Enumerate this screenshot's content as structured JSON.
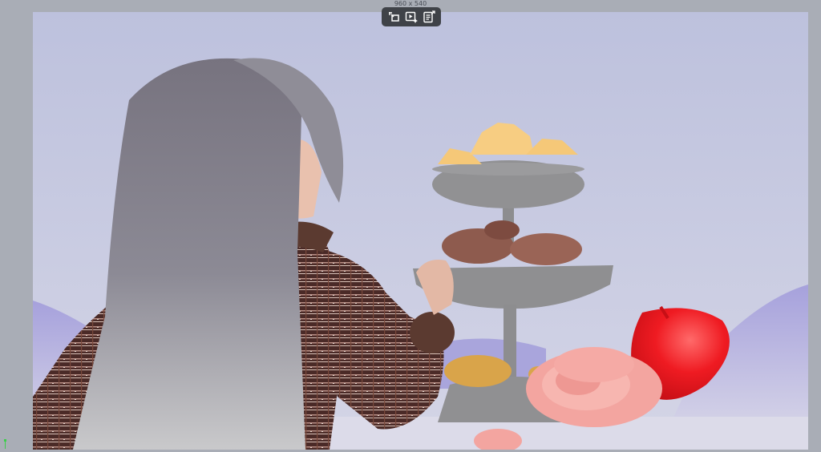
{
  "canvas": {
    "size_label": "960 x 540"
  },
  "toolbar": {
    "buttons": [
      {
        "name": "crop-frame-icon"
      },
      {
        "name": "play-sparkle-icon"
      },
      {
        "name": "notes-export-icon"
      }
    ]
  },
  "colors": {
    "sky": "#c6c9e0",
    "ground": "#b7b4dd",
    "hair": "#8a8893",
    "sweater": "#4b2c28",
    "stand": "#8d8d8f",
    "apple": "#ef1b22",
    "rose": "#f5a8a3",
    "gold": "#f5c878"
  }
}
